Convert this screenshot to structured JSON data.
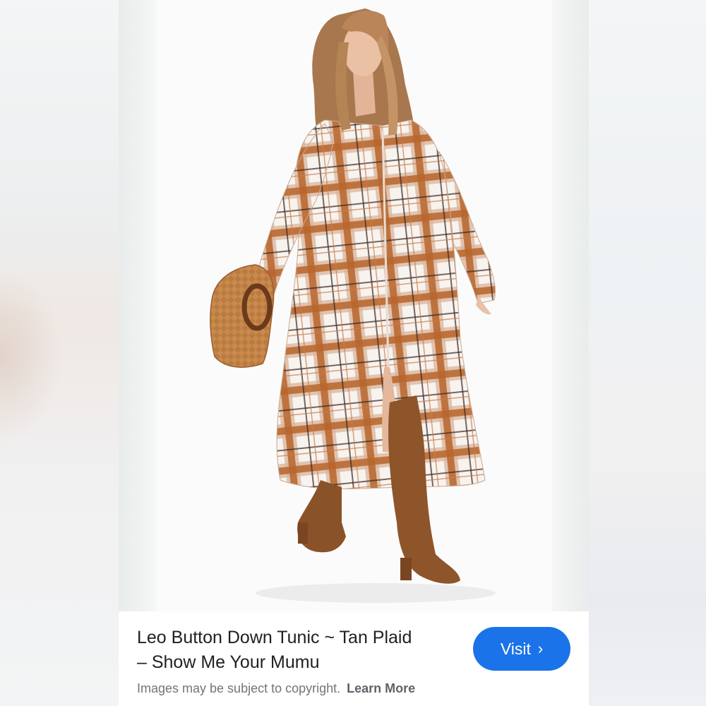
{
  "result": {
    "title_line1": "Leo Button Down Tunic ~ Tan Plaid",
    "title_line2": "– Show Me Your Mumu",
    "visit_label": "Visit",
    "copyright_text": "Images may be subject to copyright.",
    "learn_more_label": "Learn More"
  },
  "icons": {
    "visit_chevron": "chevron-right-icon"
  },
  "colors": {
    "accent": "#1a73e8",
    "plaid_rust": "#b8652c",
    "plaid_tan": "#d9b49a",
    "boots": "#8a5228"
  }
}
